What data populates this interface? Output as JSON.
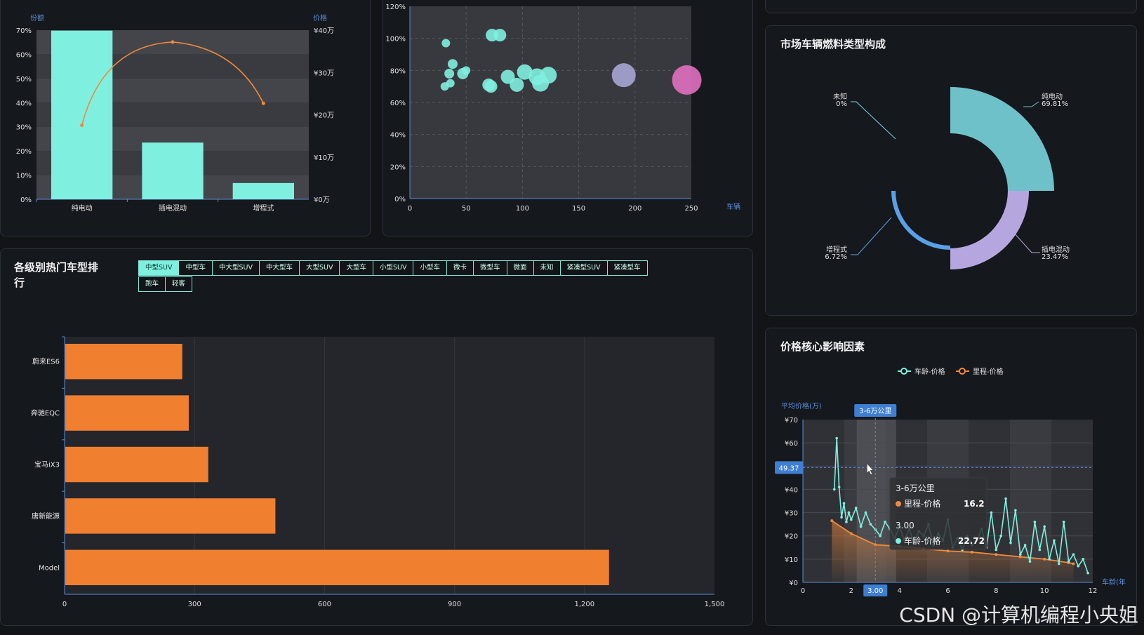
{
  "combo": {
    "y_left_title": "份额",
    "y_right_title": "价格",
    "y_left_ticks": [
      "70%",
      "60%",
      "50%",
      "40%",
      "30%",
      "20%",
      "10%",
      "0%"
    ],
    "y_right_ticks": [
      "¥40万",
      "¥30万",
      "¥20万",
      "¥10万",
      "¥0万"
    ],
    "categories": [
      "纯电动",
      "插电混动",
      "增程式"
    ]
  },
  "bubble": {
    "x_title": "车辆",
    "x_ticks": [
      "0",
      "50",
      "100",
      "150",
      "200",
      "250"
    ],
    "y_ticks": [
      "120%",
      "100%",
      "80%",
      "60%",
      "40%",
      "20%",
      "0%"
    ]
  },
  "donut": {
    "title": "市场车辆燃料类型构成",
    "labels": [
      {
        "name": "未知",
        "pct": "0%"
      },
      {
        "name": "纯电动",
        "pct": "69.81%"
      },
      {
        "name": "增程式",
        "pct": "6.72%"
      },
      {
        "name": "插电混动",
        "pct": "23.47%"
      }
    ]
  },
  "ranking": {
    "title_line1": "各级别热门车型排",
    "title_line2": "行",
    "tabs": [
      "中型SUV",
      "中型车",
      "中大型SUV",
      "中大型车",
      "大型SUV",
      "大型车",
      "小型SUV",
      "小型车",
      "微卡",
      "微型车",
      "微面",
      "未知",
      "紧凑型SUV",
      "紧凑型车",
      "跑车",
      "轻客"
    ],
    "x_ticks": [
      "0",
      "300",
      "600",
      "900",
      "1,200",
      "1,500"
    ]
  },
  "factors": {
    "title": "价格核心影响因素",
    "legend": [
      "车龄-价格",
      "里程-价格"
    ],
    "y_title": "平均价格(万)",
    "y_ticks": [
      "¥70",
      "¥60",
      "¥50",
      "¥40",
      "¥30",
      "¥20",
      "¥10",
      "¥0"
    ],
    "x_ticks": [
      "0",
      "2",
      "4",
      "6",
      "8",
      "10",
      "12"
    ],
    "x_title": "车龄(年",
    "axis_pointer_top": "3-6万公里",
    "axis_pointer_y": "49.37",
    "axis_pointer_x": "3.00",
    "tooltip": {
      "header1": "3-6万公里",
      "row1_name": "里程-价格",
      "row1_value": "16.2",
      "header2": "3.00",
      "row2_name": "车龄-价格",
      "row2_value": "22.72"
    }
  },
  "watermark": "CSDN @计算机编程小央姐",
  "chart_data": [
    {
      "type": "bar",
      "categories": [
        "纯电动",
        "插电混动",
        "增程式"
      ],
      "series": [
        {
          "name": "份额",
          "values": [
            69.81,
            23.47,
            6.72
          ]
        },
        {
          "name": "价格",
          "values": [
            17.5,
            37.2,
            22.7
          ]
        }
      ],
      "ylim": [
        0,
        70
      ],
      "y2lim": [
        0,
        40
      ],
      "ylabel": "份额",
      "y2label": "价格"
    },
    {
      "type": "scatter",
      "xlim": [
        0,
        250
      ],
      "ylim": [
        0,
        120
      ],
      "xlabel": "车辆",
      "points": [
        {
          "x": 32,
          "y": 97,
          "r": 6,
          "c": "#7ff0df"
        },
        {
          "x": 38,
          "y": 84,
          "r": 7,
          "c": "#7ff0df"
        },
        {
          "x": 35,
          "y": 78,
          "r": 7,
          "c": "#7ff0df"
        },
        {
          "x": 47,
          "y": 78,
          "r": 8,
          "c": "#7ff0df"
        },
        {
          "x": 50,
          "y": 80,
          "r": 6,
          "c": "#7ff0df"
        },
        {
          "x": 36,
          "y": 72,
          "r": 6,
          "c": "#7ff0df"
        },
        {
          "x": 31,
          "y": 70,
          "r": 6,
          "c": "#7ff0df"
        },
        {
          "x": 73,
          "y": 102,
          "r": 9,
          "c": "#7ff0df"
        },
        {
          "x": 80,
          "y": 102,
          "r": 9,
          "c": "#7ff0df"
        },
        {
          "x": 70,
          "y": 71,
          "r": 9,
          "c": "#7ff0df"
        },
        {
          "x": 72,
          "y": 70,
          "r": 9,
          "c": "#7ff0df"
        },
        {
          "x": 87,
          "y": 76,
          "r": 10,
          "c": "#7ff0df"
        },
        {
          "x": 95,
          "y": 71,
          "r": 10,
          "c": "#7ff0df"
        },
        {
          "x": 102,
          "y": 79,
          "r": 11,
          "c": "#7ff0df"
        },
        {
          "x": 113,
          "y": 76,
          "r": 12,
          "c": "#7ff0df"
        },
        {
          "x": 116,
          "y": 72,
          "r": 12,
          "c": "#7ff0df"
        },
        {
          "x": 123,
          "y": 77,
          "r": 12,
          "c": "#7ff0df"
        },
        {
          "x": 190,
          "y": 77,
          "r": 17,
          "c": "#a7a6d4"
        },
        {
          "x": 246,
          "y": 74,
          "r": 21,
          "c": "#e070c0"
        }
      ]
    },
    {
      "type": "pie",
      "labels": [
        "纯电动",
        "插电混动",
        "增程式",
        "未知"
      ],
      "values": [
        69.81,
        23.47,
        6.72,
        0
      ],
      "colors": [
        "#6fc1c9",
        "#b6a6e0",
        "#5aa0e8",
        "#7ad3f1"
      ]
    },
    {
      "type": "bar",
      "categories": [
        "蔚来ES6",
        "奔驰EQC",
        "宝马iX3",
        "唐新能源",
        "Model"
      ],
      "values": [
        270,
        285,
        330,
        485,
        1255
      ],
      "xlim": [
        0,
        1500
      ]
    },
    {
      "type": "line",
      "xlim": [
        0,
        12
      ],
      "ylim": [
        0,
        70
      ],
      "ylabel": "平均价格(万)",
      "xlabel": "车龄(年",
      "series": [
        {
          "name": "车龄-价格",
          "x": [
            1.3,
            1.4,
            1.5,
            1.6,
            1.7,
            1.8,
            1.9,
            2.0,
            2.2,
            2.4,
            2.6,
            2.8,
            3.0,
            3.2,
            3.4,
            3.6,
            3.8,
            4.0,
            4.2,
            4.4,
            4.6,
            4.8,
            5.0,
            5.2,
            5.4,
            5.6,
            5.8,
            6.0,
            6.2,
            6.4,
            6.6,
            6.8,
            7.0,
            7.2,
            7.4,
            7.6,
            7.8,
            8.0,
            8.2,
            8.4,
            8.6,
            8.8,
            9.0,
            9.2,
            9.4,
            9.6,
            9.8,
            10.0,
            10.2,
            10.4,
            10.6,
            10.8,
            11.0,
            11.2,
            11.4,
            11.6,
            11.8
          ],
          "values": [
            40,
            62,
            41,
            28,
            34,
            26,
            30,
            27,
            32,
            24,
            30,
            25,
            22.72,
            20,
            26,
            23,
            19,
            24,
            18,
            23,
            17,
            22,
            20,
            25,
            16,
            21,
            18,
            27,
            15,
            19,
            14,
            20,
            16,
            18,
            23,
            15,
            30,
            14,
            20,
            36,
            17,
            31,
            12,
            16,
            9,
            26,
            14,
            24,
            10,
            18,
            8,
            26,
            9,
            12,
            7,
            10,
            4
          ]
        },
        {
          "name": "里程-价格",
          "x": [
            1.2,
            2,
            3,
            4,
            5,
            6,
            7,
            8,
            9,
            10,
            11,
            11.2
          ],
          "values": [
            26.5,
            21,
            16.2,
            15.5,
            14.5,
            13.5,
            13,
            12,
            11,
            10,
            8.5,
            8
          ]
        }
      ]
    }
  ]
}
